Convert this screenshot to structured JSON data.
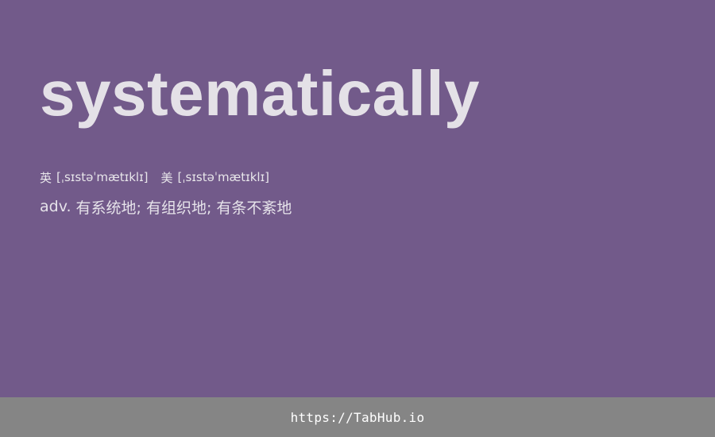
{
  "entry": {
    "word": "systematically",
    "phonetics": {
      "uk_label": "英",
      "uk_ipa": "[ˌsɪstəˈmætɪklɪ]",
      "us_label": "美",
      "us_ipa": "[ˌsɪstəˈmætɪklɪ]"
    },
    "definition": {
      "part_of_speech": "adv.",
      "meaning": "有系统地; 有组织地; 有条不紊地"
    }
  },
  "footer": {
    "url": "https://TabHub.io"
  },
  "colors": {
    "background": "#725a8a",
    "footer_background": "#858585",
    "text": "#e4e1e7"
  }
}
